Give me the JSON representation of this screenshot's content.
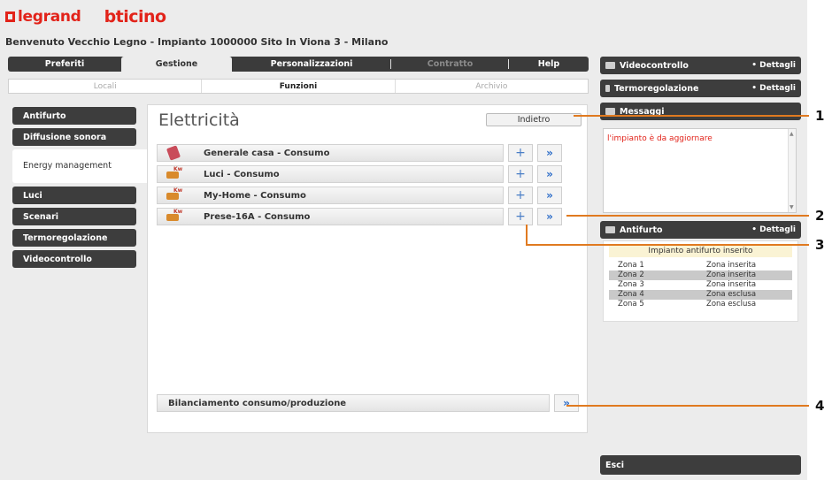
{
  "brand": {
    "legrand": "legrand",
    "bticino": "bticino"
  },
  "welcome": "Benvenuto Vecchio Legno - Impianto 1000000 Sito In Viona 3 - Milano",
  "tabs": [
    {
      "label": "Preferiti"
    },
    {
      "label": "Gestione"
    },
    {
      "label": "Personalizzazioni"
    },
    {
      "label": "Contratto"
    },
    {
      "label": "Help"
    }
  ],
  "subtabs": [
    {
      "label": "Locali"
    },
    {
      "label": "Funzioni"
    },
    {
      "label": "Archivio"
    }
  ],
  "menu": [
    {
      "label": "Antifurto"
    },
    {
      "label": "Diffusione sonora"
    },
    {
      "label": "Energy management"
    },
    {
      "label": "Luci"
    },
    {
      "label": "Scenari"
    },
    {
      "label": "Termoregolazione"
    },
    {
      "label": "Videocontrollo"
    }
  ],
  "main": {
    "title": "Elettricità",
    "back_label": "Indietro",
    "rows": [
      {
        "label": "Generale casa - Consumo"
      },
      {
        "label": "Luci - Consumo"
      },
      {
        "label": "My-Home - Consumo"
      },
      {
        "label": "Prese-16A - Consumo"
      }
    ],
    "balance_label": "Bilanciamento consumo/produzione",
    "graph_icon": "+",
    "detail_icon": "»"
  },
  "right": {
    "videocontrollo": {
      "title": "Videocontrollo",
      "details": "• Dettagli"
    },
    "termoregolazione": {
      "title": "Termoregolazione",
      "details": "• Dettagli"
    },
    "messaggi": {
      "title": "Messaggi",
      "text": "l'impianto è da aggiornare"
    },
    "antifurto": {
      "title": "Antifurto",
      "details": "• Dettagli",
      "status": "Impianto antifurto inserito",
      "zones": [
        {
          "name": "Zona 1",
          "state": "Zona inserita"
        },
        {
          "name": "Zona 2",
          "state": "Zona inserita"
        },
        {
          "name": "Zona 3",
          "state": "Zona inserita"
        },
        {
          "name": "Zona 4",
          "state": "Zona esclusa"
        },
        {
          "name": "Zona 5",
          "state": "Zona esclusa"
        }
      ]
    },
    "exit": "Esci"
  },
  "callouts": [
    "1",
    "2",
    "3",
    "4"
  ],
  "colors": {
    "accent": "#e2231a",
    "callout": "#e07a20",
    "dark_bar": "#3d3d3d",
    "link_blue": "#2a6bc8"
  }
}
